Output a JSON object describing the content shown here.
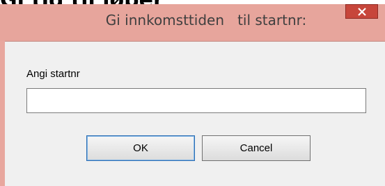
{
  "page": {
    "heading": "Gi tid til løper"
  },
  "dialog": {
    "title": "Gi innkomsttiden   til startnr:",
    "close_icon": "close-icon",
    "field_label": "Angi startnr",
    "input_value": "",
    "ok_label": "OK",
    "cancel_label": "Cancel"
  },
  "colors": {
    "titlebar": "#e7a59c",
    "close_button": "#c7463b",
    "client_bg": "#f0f0f0"
  }
}
